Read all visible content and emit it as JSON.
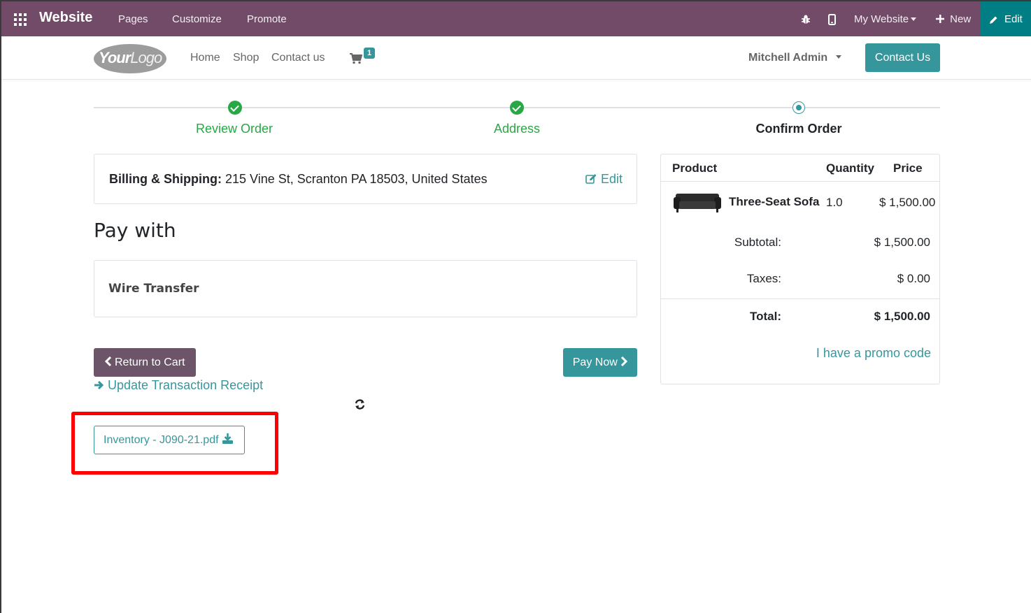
{
  "adminbar": {
    "brand": "Website",
    "menus": [
      "Pages",
      "Customize",
      "Promote"
    ],
    "site_selector": "My Website",
    "new_label": "New",
    "edit_label": "Edit",
    "colors": {
      "bar": "#714b67",
      "edit": "#017e84"
    }
  },
  "header": {
    "logo_text_bold": "Your",
    "logo_text_light": "Logo",
    "nav": [
      "Home",
      "Shop",
      "Contact us"
    ],
    "cart_count": "1",
    "user": "Mitchell Admin",
    "contact_button": "Contact Us"
  },
  "wizard": {
    "steps": [
      {
        "label": "Review Order",
        "state": "done"
      },
      {
        "label": "Address",
        "state": "done"
      },
      {
        "label": "Confirm Order",
        "state": "current"
      }
    ]
  },
  "billing": {
    "label": "Billing & Shipping:",
    "address": "215 Vine St, Scranton PA 18503, United States",
    "edit_label": "Edit"
  },
  "payment": {
    "heading": "Pay with",
    "method": "Wire Transfer"
  },
  "actions": {
    "return_label": "Return to Cart",
    "pay_label": "Pay Now",
    "update_label": "Update Transaction Receipt",
    "attachment": "Inventory - J090-21.pdf"
  },
  "summary": {
    "headers": {
      "product": "Product",
      "quantity": "Quantity",
      "price": "Price"
    },
    "line": {
      "name": "Three-Seat Sofa",
      "qty": "1.0",
      "price": "$ 1,500.00"
    },
    "subtotal_label": "Subtotal:",
    "subtotal": "$ 1,500.00",
    "taxes_label": "Taxes:",
    "taxes": "$ 0.00",
    "total_label": "Total:",
    "total": "$ 1,500.00",
    "promo": "I have a promo code"
  },
  "colors": {
    "accent": "#35979c",
    "success": "#28a745",
    "secondary": "#6c5469",
    "highlight": "#ff0000"
  }
}
